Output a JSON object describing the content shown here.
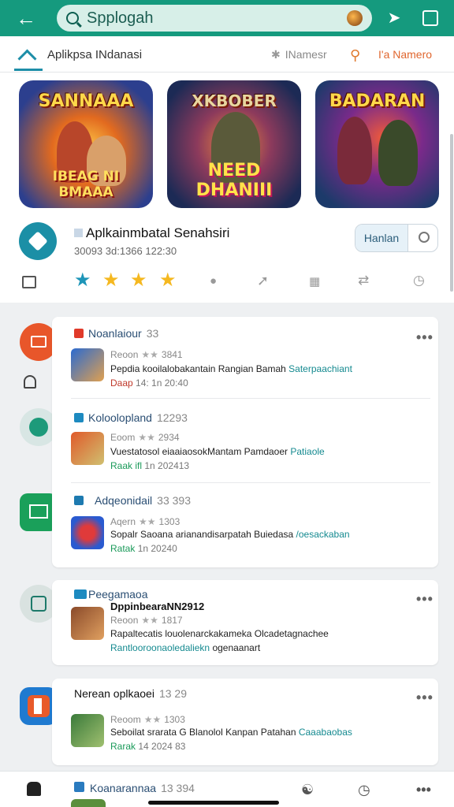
{
  "topbar": {
    "search_text": "Spplogah"
  },
  "tabs": {
    "home_label": "Aplikpsa INdanasi",
    "tab2_label": "INamesr",
    "tab4_label": "I'a Namero"
  },
  "banner": {
    "games": [
      {
        "title": "SANNAAA",
        "subtitle": "IBEAG NI BMAAA"
      },
      {
        "title": "XKBOBER",
        "subtitle": "NEED DHANIII"
      },
      {
        "title": "BADARAN",
        "subtitle": ""
      }
    ]
  },
  "featured": {
    "title": "Aplkainmbatal Senahsiri",
    "subtitle": "30093 3d:1366 122:30",
    "install_label": "Hanlan",
    "stars_filled": 4,
    "colors": {
      "first_star": "#1d95b8",
      "star": "#f5b820"
    }
  },
  "list": {
    "groups": [
      {
        "name": "Noanlaiour",
        "count": "33",
        "icon": "mail-icon",
        "icon_color": "#e25a2a",
        "meta": "Reoon",
        "rating": "3841",
        "desc": "Pepdia kooilalobakantain Rangian Bamah ",
        "desc_hl": "Saterpaachiant",
        "tag_g": "Daap",
        "tag": "14: 1n 20:40"
      },
      {
        "name": "Koloolopland",
        "count": "12293",
        "icon": "refresh-icon",
        "icon_color": "#1d9a7a",
        "meta": "Eoom",
        "rating": "2934",
        "desc": "Vuestatosol eiaaiaosokMantam Pamdaoer ",
        "desc_hl": "Patiaole",
        "tag_g": "Raak ifl",
        "tag": "1n 202413"
      },
      {
        "name": "Adqeonidail",
        "count": "33 393",
        "icon": "image-icon",
        "icon_color": "#1a9a52",
        "meta": "Aqern",
        "rating": "1303",
        "desc": "Sopalr Saoana arianandisarpatah Buiedasa ",
        "desc_hl": "/oesackaban",
        "tag_g": "Ratak",
        "tag": "1n 20240"
      },
      {
        "name": "Peegamaoa",
        "count": "",
        "icon": "photo-icon",
        "icon_color": "#1d8a7a",
        "title2": "DppinbearaNN2912",
        "meta": "Reoon",
        "rating": "1817",
        "desc": "Rapaltecatis louolenarckakameka Olcadetagnachee",
        "desc_hl": "",
        "tag_g": "Rantlooroonaoledaliekn",
        "tag": "ogenaanart"
      },
      {
        "name": "Nerean oplkaoei",
        "count": "13 29",
        "icon": "chat-icon",
        "icon_color": "#e85a2a",
        "meta": "Reoom",
        "rating": "1303",
        "desc": "Seboilat srarata G Blanolol Kanpan Patahan ",
        "desc_hl": "Caaabaobas",
        "tag_g": "Rarak",
        "tag": "14 2024 83"
      }
    ]
  },
  "bottomnav": {
    "label": "Koanarannaa",
    "count": "13 394"
  }
}
